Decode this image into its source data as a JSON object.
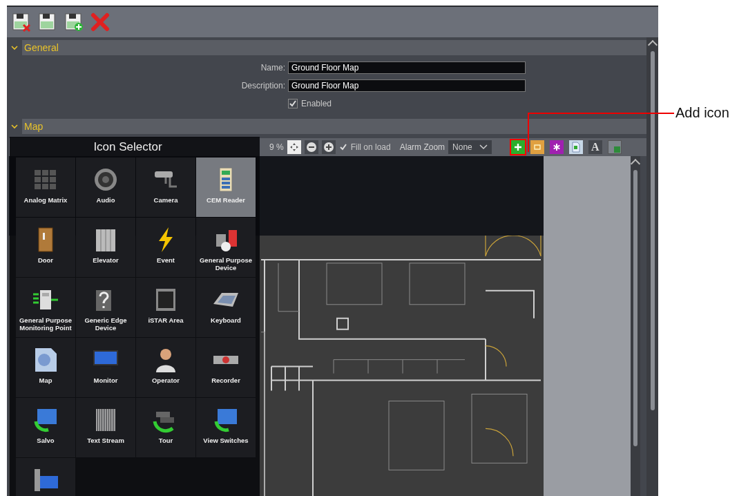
{
  "toolbar": {
    "buttons": [
      {
        "kind": "save-close"
      },
      {
        "kind": "save"
      },
      {
        "kind": "save-new"
      },
      {
        "kind": "delete"
      }
    ]
  },
  "general": {
    "title": "General",
    "expanded": true,
    "fields": [
      {
        "label": "Name:",
        "value": "Ground Floor Map"
      },
      {
        "label": "Description:",
        "value": "Ground Floor Map"
      }
    ],
    "enabled": {
      "label": "Enabled",
      "checked": true
    }
  },
  "map": {
    "title": "Map",
    "expanded": true,
    "zoom_reading": "9 %",
    "fill_on_load": {
      "label": "Fill on load",
      "checked": true
    },
    "alarm_zoom": {
      "label": "Alarm Zoom",
      "value": "None"
    },
    "tools": [
      {
        "kind": "add",
        "selected": true
      },
      {
        "kind": "folder",
        "selected": false
      },
      {
        "kind": "star",
        "selected": false
      },
      {
        "kind": "page",
        "selected": false
      },
      {
        "kind": "text",
        "label": "A",
        "selected": false
      },
      {
        "kind": "corner",
        "selected": false
      }
    ]
  },
  "icon_selector": {
    "title": "Icon Selector",
    "tiles": [
      {
        "label": "Analog Matrix",
        "selected": false
      },
      {
        "label": "Audio",
        "selected": false
      },
      {
        "label": "Camera",
        "selected": false
      },
      {
        "label": "CEM Reader",
        "selected": true
      },
      {
        "label": "Door",
        "selected": false
      },
      {
        "label": "Elevator",
        "selected": false
      },
      {
        "label": "Event",
        "selected": false
      },
      {
        "label": "General Purpose Device",
        "selected": false
      },
      {
        "label": "General Purpose Monitoring Point",
        "selected": false
      },
      {
        "label": "Generic Edge Device",
        "selected": false
      },
      {
        "label": "iSTAR Area",
        "selected": false
      },
      {
        "label": "Keyboard",
        "selected": false
      },
      {
        "label": "Map",
        "selected": false
      },
      {
        "label": "Monitor",
        "selected": false
      },
      {
        "label": "Operator",
        "selected": false
      },
      {
        "label": "Recorder",
        "selected": false
      },
      {
        "label": "Salvo",
        "selected": false
      },
      {
        "label": "Text Stream",
        "selected": false
      },
      {
        "label": "Tour",
        "selected": false
      },
      {
        "label": "View Switches",
        "selected": false
      },
      {
        "selected": false
      }
    ]
  },
  "annotation": {
    "label": "Add icon"
  }
}
